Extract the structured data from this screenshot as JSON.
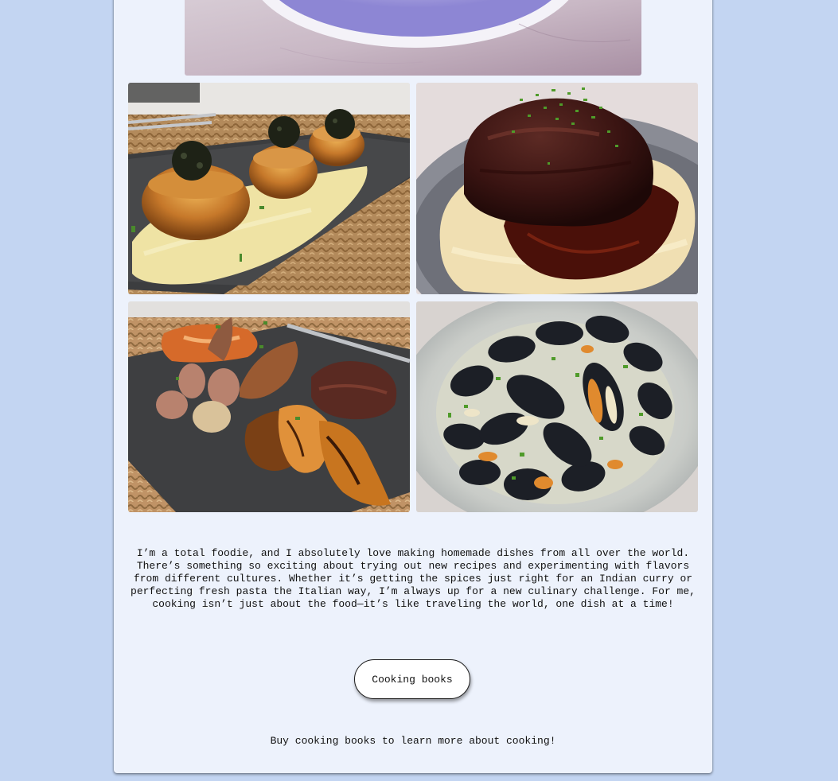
{
  "gallery": {
    "photos": [
      {
        "name": "top-plate-photo",
        "alt": "Plate on a marble table"
      },
      {
        "name": "seared-scallops-photo",
        "alt": "Seared scallops with caviar on mashed potatoes"
      },
      {
        "name": "braised-short-rib-photo",
        "alt": "Braised short rib with chives over mashed potatoes"
      },
      {
        "name": "steak-and-shrimp-photo",
        "alt": "Steak, grilled shrimp and roasted shallots on slate"
      },
      {
        "name": "steamed-mussels-photo",
        "alt": "Steamed mussels in white wine sauce"
      }
    ]
  },
  "intro": {
    "text": "I’m a total foodie, and I absolutely love making homemade dishes from all over the world. There’s something so exciting about trying out new recipes and experimenting with flavors from different cultures. Whether it’s getting the spices just right for an Indian curry or perfecting fresh pasta the Italian way, I’m always up for a new culinary challenge. For me, cooking isn’t just about the food—it’s like traveling the world, one dish at a time!"
  },
  "cta": {
    "button_label": "Cooking books",
    "caption": "Buy cooking books to learn more about cooking!"
  },
  "colors": {
    "page_background": "#c3d5f2",
    "card_background": "#edf2fc"
  }
}
